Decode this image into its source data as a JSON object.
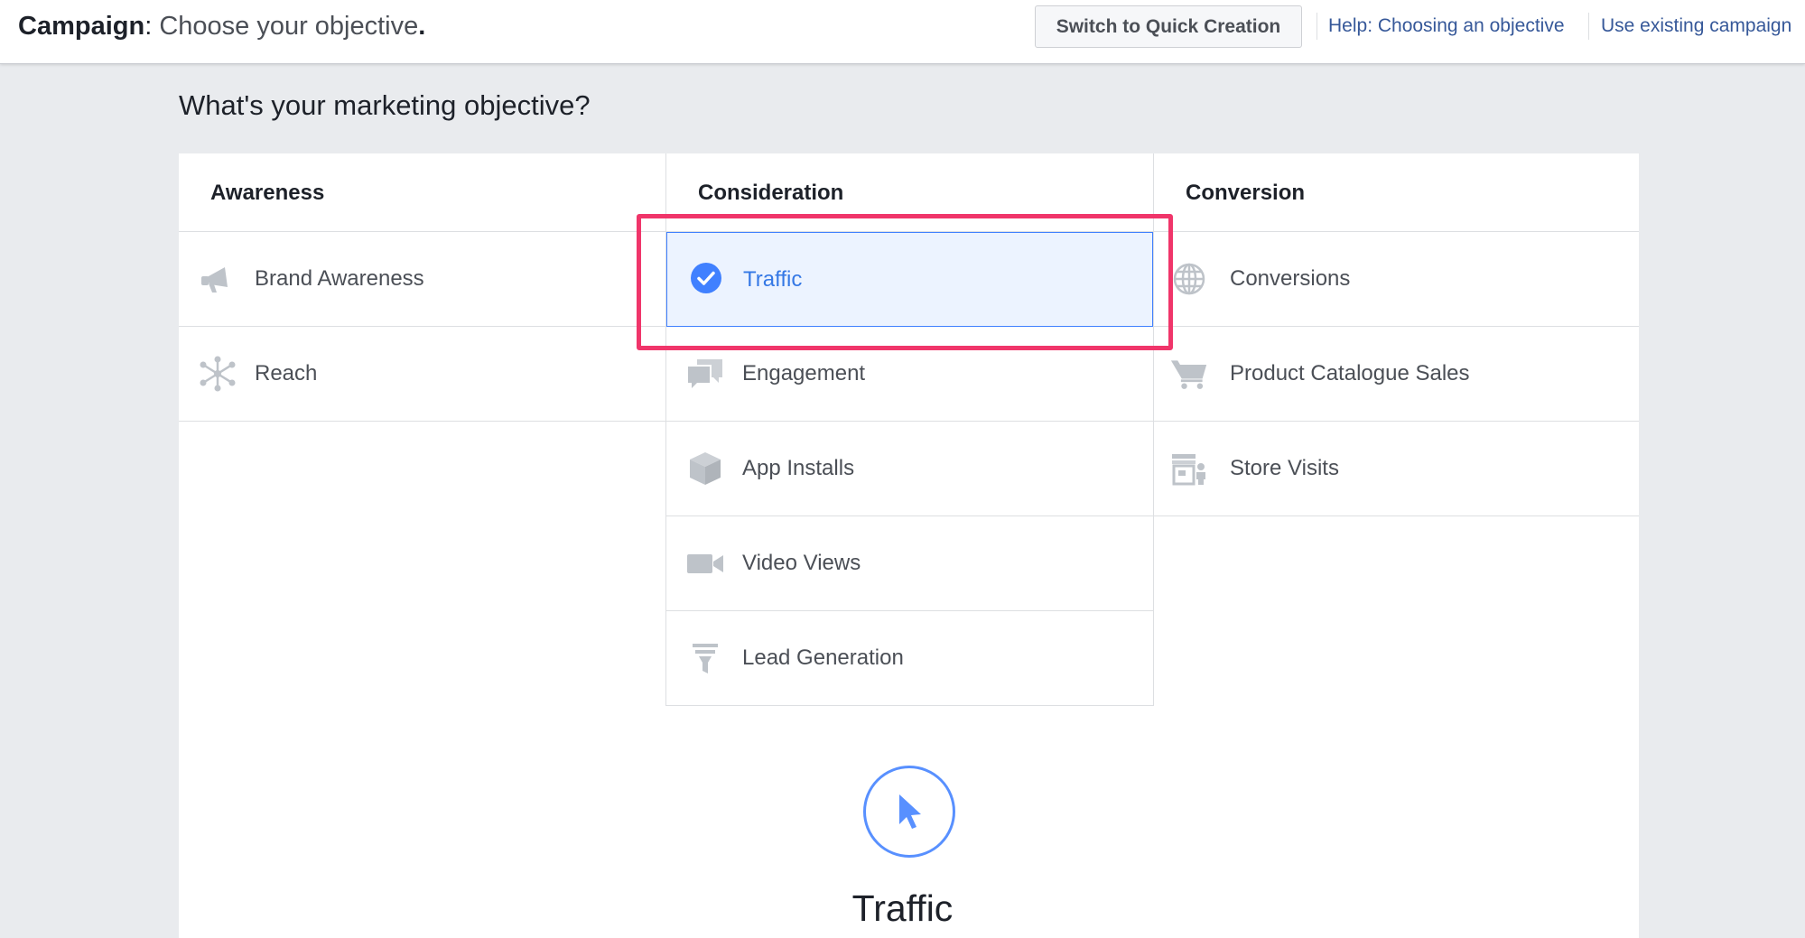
{
  "header": {
    "title_strong": "Campaign",
    "title_colon": ": ",
    "title_sub": "Choose your objective",
    "title_dot": ".",
    "quick_creation_label": "Switch to Quick Creation",
    "help_link": "Help: Choosing an objective",
    "existing_link": "Use existing campaign"
  },
  "main": {
    "heading": "What's your marketing objective?"
  },
  "columns": [
    {
      "title": "Awareness",
      "items": [
        {
          "label": "Brand Awareness",
          "icon": "megaphone-icon"
        },
        {
          "label": "Reach",
          "icon": "reach-icon"
        }
      ]
    },
    {
      "title": "Consideration",
      "items": [
        {
          "label": "Traffic",
          "icon": "check-circle-icon",
          "selected": true
        },
        {
          "label": "Engagement",
          "icon": "chat-bubbles-icon"
        },
        {
          "label": "App Installs",
          "icon": "box-icon"
        },
        {
          "label": "Video Views",
          "icon": "video-camera-icon"
        },
        {
          "label": "Lead Generation",
          "icon": "funnel-icon"
        }
      ]
    },
    {
      "title": "Conversion",
      "items": [
        {
          "label": "Conversions",
          "icon": "globe-icon"
        },
        {
          "label": "Product Catalogue Sales",
          "icon": "cart-icon"
        },
        {
          "label": "Store Visits",
          "icon": "store-icon"
        }
      ]
    }
  ],
  "detail": {
    "title": "Traffic",
    "icon": "cursor-icon"
  },
  "colors": {
    "accent": "#3578e5",
    "selected_bg": "#ecf3ff",
    "highlight": "#f0356a",
    "icon_gray": "#bec3c9",
    "link": "#365899"
  }
}
